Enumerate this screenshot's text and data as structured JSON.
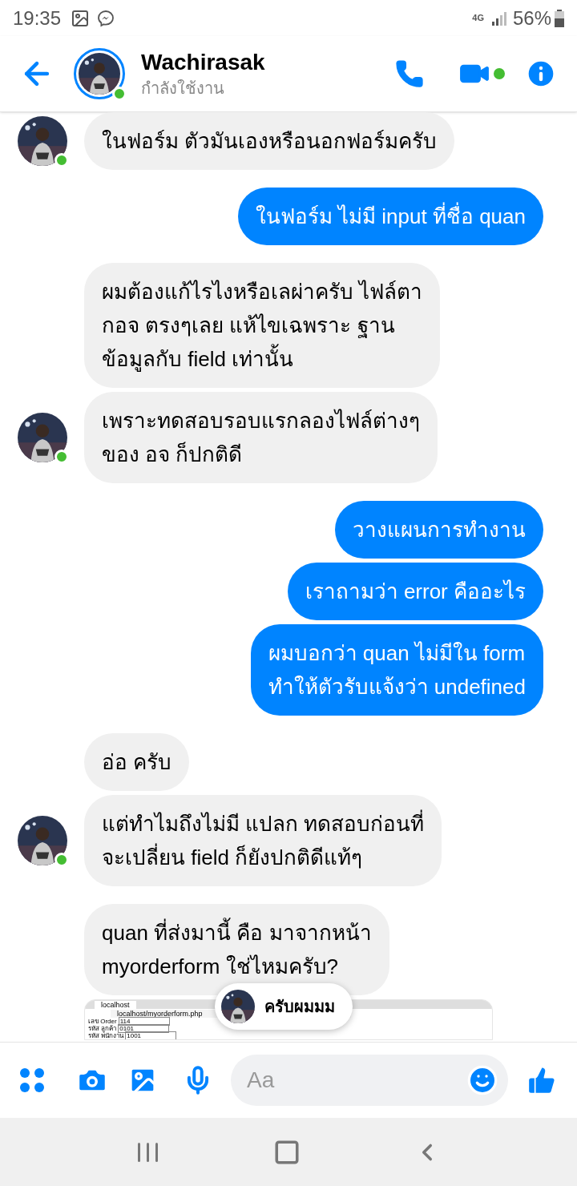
{
  "status_bar": {
    "time": "19:35",
    "network": "4G",
    "battery": "56%"
  },
  "header": {
    "name": "Wachirasak",
    "status": "กำลังใช้งาน",
    "has_story": true,
    "online": true
  },
  "groups": [
    {
      "kind": "incoming",
      "messages": [
        {
          "kind": "text",
          "text": "ในฟอร์ม ตัวมันเองหรือนอกฟอร์มครับ",
          "avatar": true,
          "online": true
        }
      ]
    },
    {
      "kind": "outgoing",
      "messages": [
        {
          "kind": "text",
          "text": "ในฟอร์ม ไม่มี input ที่ชื่อ quan"
        }
      ]
    },
    {
      "kind": "incoming",
      "messages": [
        {
          "kind": "text",
          "text": "ผมต้องแก้ไรไงหรือเลผ่าครับ ไฟล์ตา\nกอจ ตรงๆเลย แห้ไขเฉพราะ ฐาน\nข้อมูลกับ field เท่านั้น",
          "avatar": false
        },
        {
          "kind": "text",
          "text": "เพราะทดสอบรอบแรกลองไฟล์ต่างๆ\nของ อจ ก็ปกติดี",
          "avatar": true,
          "online": true
        }
      ]
    },
    {
      "kind": "outgoing",
      "messages": [
        {
          "kind": "text",
          "text": "วางแผนการทำงาน"
        },
        {
          "kind": "text",
          "text": "เราถามว่า error คืออะไร"
        },
        {
          "kind": "text",
          "text": "ผมบอกว่า quan ไม่มีใน form\nทำให้ตัวรับแจ้งว่า undefined"
        }
      ]
    },
    {
      "kind": "incoming",
      "messages": [
        {
          "kind": "text",
          "text": "อ่อ ครับ",
          "avatar": false
        },
        {
          "kind": "text",
          "text": "แต่ทำไมถึงไม่มี แปลก ทดสอบก่อนที่\nจะเปลี่ยน field ก็ยังปกติดีแท้ๆ",
          "avatar": true,
          "online": true
        }
      ]
    },
    {
      "kind": "incoming",
      "messages": [
        {
          "kind": "text",
          "text": "quan ที่ส่งมานี้ คือ มาจากหน้า\nmyorderform ใช่ไหมครับ?",
          "avatar": false
        },
        {
          "kind": "screenshot",
          "tab": "localhost",
          "url": "localhost/myorderform.php",
          "rows": [
            {
              "label": "เลข Order",
              "value": "114"
            },
            {
              "label": "รหัส ลูกค้า",
              "value": "0101"
            },
            {
              "label": "รหัส พนักงาน",
              "value": "1001"
            }
          ],
          "avatar": false
        }
      ]
    }
  ],
  "toast": {
    "text": "ครับผมมม"
  },
  "composer": {
    "placeholder": "Aa"
  }
}
